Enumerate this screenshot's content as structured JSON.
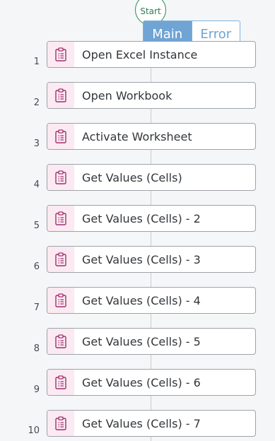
{
  "flow": {
    "start_label": "Start",
    "tabs": [
      {
        "label": "Main",
        "active": true
      },
      {
        "label": "Error",
        "active": false
      }
    ],
    "icon_name": "clipboard-list-icon",
    "colors": {
      "start_ring": "#2e8b57",
      "tab_active": "#6fa4d4",
      "icon_accent": "#a0306e",
      "icon_bg": "#fbeaf2"
    },
    "steps": [
      {
        "number": "1",
        "label": "Open Excel Instance"
      },
      {
        "number": "2",
        "label": "Open Workbook"
      },
      {
        "number": "3",
        "label": "Activate Worksheet"
      },
      {
        "number": "4",
        "label": "Get Values (Cells)"
      },
      {
        "number": "5",
        "label": "Get Values (Cells) - 2"
      },
      {
        "number": "6",
        "label": "Get Values (Cells) - 3"
      },
      {
        "number": "7",
        "label": "Get Values (Cells) - 4"
      },
      {
        "number": "8",
        "label": "Get Values (Cells) - 5"
      },
      {
        "number": "9",
        "label": "Get Values (Cells) - 6"
      },
      {
        "number": "10",
        "label": "Get Values (Cells) - 7"
      }
    ]
  }
}
